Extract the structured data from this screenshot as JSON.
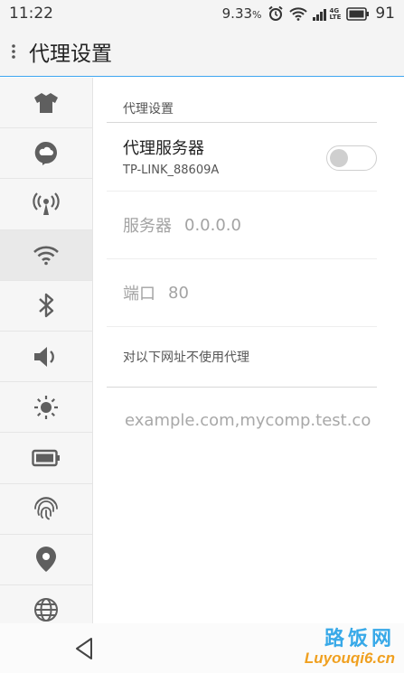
{
  "status_bar": {
    "time": "11:22",
    "data_rate": "9.33",
    "data_rate_unit": "%",
    "network_type": "4G",
    "network_sub": "LTE",
    "battery_level": "91",
    "icons": [
      "alarm-icon",
      "wifi-icon",
      "signal-icon",
      "battery-icon"
    ]
  },
  "header": {
    "title": "代理设置"
  },
  "sidebar": {
    "items": [
      {
        "icon": "shirt-icon"
      },
      {
        "icon": "cloud-chat-icon"
      },
      {
        "icon": "hotspot-icon"
      },
      {
        "icon": "wifi-icon",
        "active": true
      },
      {
        "icon": "bluetooth-icon"
      },
      {
        "icon": "volume-icon"
      },
      {
        "icon": "brightness-icon"
      },
      {
        "icon": "battery-icon"
      },
      {
        "icon": "fingerprint-icon"
      },
      {
        "icon": "location-icon"
      },
      {
        "icon": "globe-icon"
      }
    ]
  },
  "main": {
    "section_title": "代理设置",
    "proxy": {
      "title": "代理服务器",
      "network": "TP-LINK_88609A",
      "enabled": false
    },
    "server": {
      "label": "服务器",
      "value": "0.0.0.0"
    },
    "port": {
      "label": "端口",
      "value": "80"
    },
    "exclude_title": "对以下网址不使用代理",
    "exclude_placeholder": "example.com,mycomp.test.co"
  },
  "nav_bar": {
    "back_icon": "back-triangle-icon"
  },
  "watermark": {
    "cn": "路饭网",
    "en": "Luyouqi6.cn"
  },
  "colors": {
    "accent": "#3ea6f0",
    "icon_gray": "#5f5f5f",
    "text_disabled": "#a3a3a3"
  }
}
